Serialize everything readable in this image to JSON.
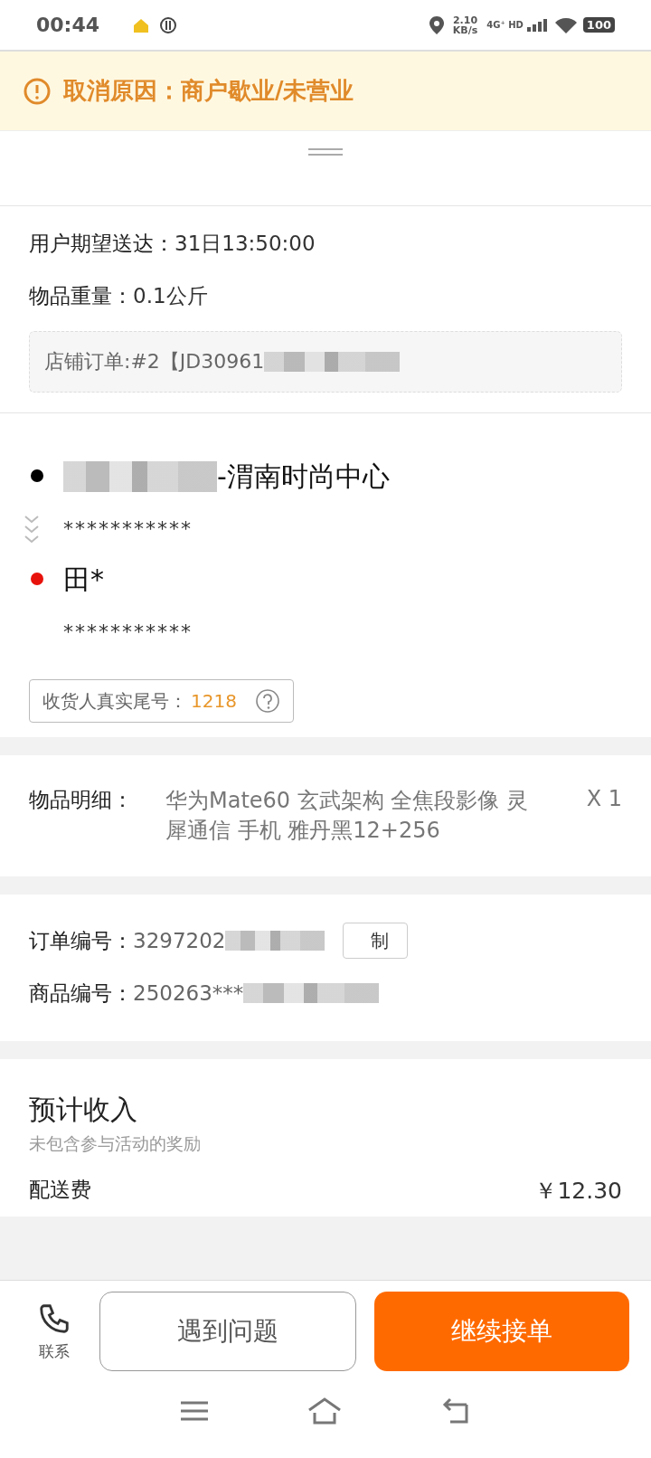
{
  "status_bar": {
    "time": "00:44",
    "speed_value": "2.10",
    "speed_unit": "KB/s",
    "network": "4G⁺ HD",
    "battery": "100"
  },
  "banner": {
    "text": "取消原因：商户歇业/未营业"
  },
  "info": {
    "expected_label": "用户期望送达：",
    "expected_value": "31日13:50:00",
    "weight_label": "物品重量：",
    "weight_value": "0.1公斤",
    "store_order": "店铺订单:#2【JD30961"
  },
  "route": [
    {
      "kind": "pickup",
      "name": "-渭南时尚中心",
      "address": "***********",
      "color": "#000000"
    },
    {
      "kind": "dropoff",
      "name": "田*",
      "address": "***********",
      "color": "#e8120c"
    }
  ],
  "tail_number": {
    "label": "收货人真实尾号：",
    "value": "1218"
  },
  "goods": {
    "label": "物品明细：",
    "text": "华为Mate60 玄武架构 全焦段影像 灵犀通信 手机 雅丹黑12+256",
    "qty": "X 1"
  },
  "codes": [
    {
      "label": "订单编号：",
      "value": "3297202",
      "copy": "制"
    },
    {
      "label": "商品编号：",
      "value": "250263***"
    }
  ],
  "income": {
    "title": "预计收入",
    "subtitle": "未包含参与活动的奖励",
    "rows": [
      {
        "label": "配送费",
        "value": "￥12.30"
      }
    ]
  },
  "actions": {
    "contact": "联系",
    "problem": "遇到问题",
    "continue": "继续接单"
  }
}
